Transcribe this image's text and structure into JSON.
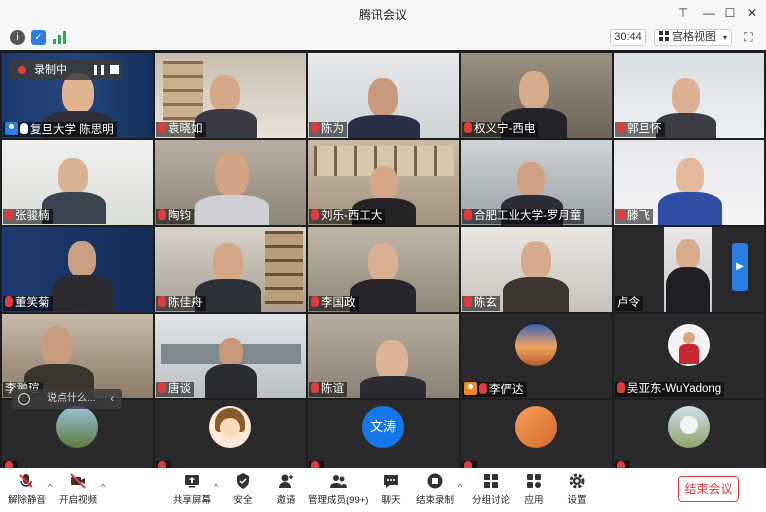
{
  "window": {
    "title": "腾讯会议"
  },
  "toolbar": {
    "timer": "30:44",
    "view_label": "宫格视图"
  },
  "recording": {
    "label": "录制中"
  },
  "chat": {
    "placeholder": "说点什么..."
  },
  "tiles": [
    {
      "name": "复旦大学 陈思明",
      "mic": "on",
      "host": true
    },
    {
      "name": "袁晓如",
      "mic": "muted"
    },
    {
      "name": "陈为",
      "mic": "muted"
    },
    {
      "name": "权义宁-西电",
      "mic": "muted"
    },
    {
      "name": "郭旦怀",
      "mic": "muted"
    },
    {
      "name": "张骏楠",
      "mic": "muted"
    },
    {
      "name": "陶钧",
      "mic": "muted"
    },
    {
      "name": "刘乐-西工大",
      "mic": "muted"
    },
    {
      "name": "合肥工业大学-罗月童",
      "mic": "muted"
    },
    {
      "name": "滕飞",
      "mic": "muted"
    },
    {
      "name": "董笑菊",
      "mic": "muted"
    },
    {
      "name": "陈佳舟",
      "mic": "muted"
    },
    {
      "name": "李国政",
      "mic": "muted"
    },
    {
      "name": "陈玄",
      "mic": "muted"
    },
    {
      "name": "卢令",
      "mic": "none"
    },
    {
      "name": "李翀瑄",
      "mic": "none"
    },
    {
      "name": "唐谈",
      "mic": "muted"
    },
    {
      "name": "陈谊",
      "mic": "muted"
    },
    {
      "name": "李俨达",
      "mic": "muted",
      "host": true
    },
    {
      "name": "吴亚东-WuYadong",
      "mic": "muted"
    },
    {
      "name": "",
      "mic": "muted"
    },
    {
      "name": "",
      "mic": "muted"
    },
    {
      "name": "",
      "mic": "muted"
    },
    {
      "name": "",
      "mic": "muted"
    },
    {
      "name": "",
      "mic": "muted"
    }
  ],
  "avatar_texts": {
    "wentao": "文涛"
  },
  "bottom_bar": {
    "unmute": "解除静音",
    "start_video": "开启视频",
    "share_screen": "共享屏幕",
    "security": "安全",
    "invite": "邀请",
    "manage_members": "管理成员(99+)",
    "chat": "聊天",
    "end_recording": "结束录制",
    "breakout": "分组讨论",
    "apps": "应用",
    "settings": "设置",
    "end_meeting": "结束会议"
  },
  "colors": {
    "accent": "#2a7de1",
    "danger": "#e23b3b"
  }
}
